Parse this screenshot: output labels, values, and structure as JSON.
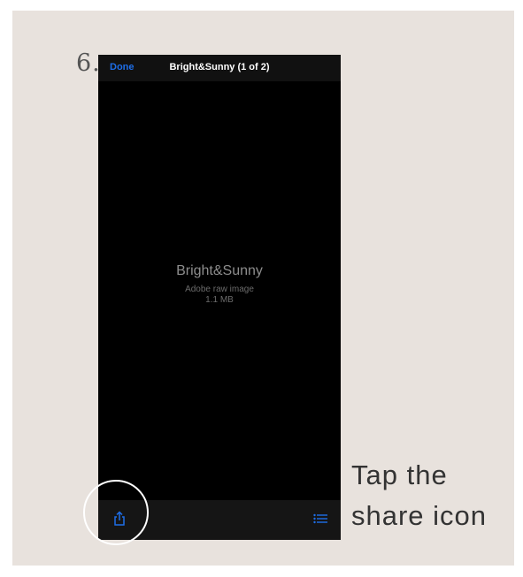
{
  "step": {
    "number": "6."
  },
  "phone": {
    "nav": {
      "done_label": "Done",
      "title": "Bright&Sunny (1 of 2)"
    },
    "file": {
      "name": "Bright&Sunny",
      "type": "Adobe raw image",
      "size": "1.1 MB"
    },
    "toolbar": {
      "left_icon": "share-icon",
      "right_icon": "list-icon"
    }
  },
  "instruction": {
    "line1": "Tap the",
    "line2": "share icon"
  },
  "colors": {
    "accent": "#1e6ee8",
    "background": "#e8e2dd",
    "screen": "#000000"
  }
}
